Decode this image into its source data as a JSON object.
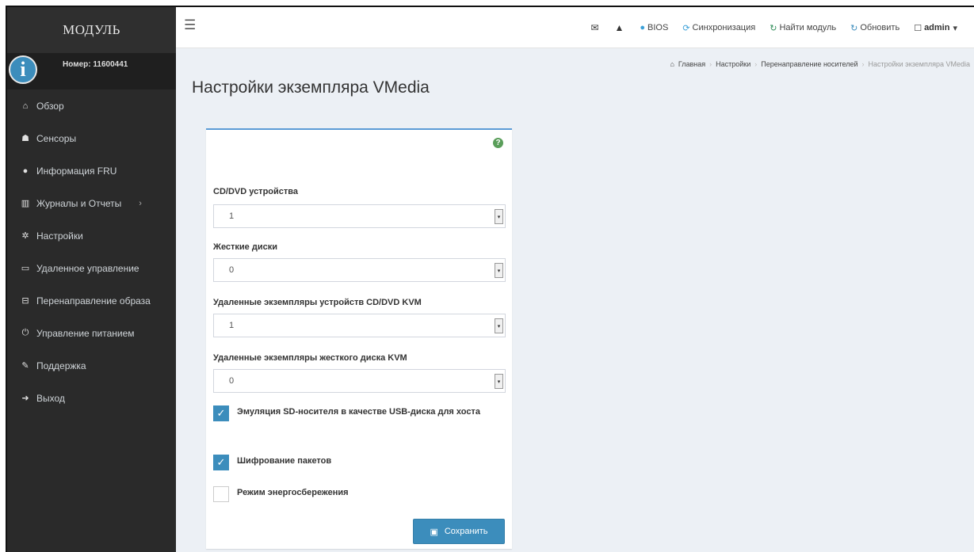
{
  "brand": "МОДУЛЬ",
  "user": {
    "number": "Номер: 11600441"
  },
  "sidebar": {
    "items": [
      {
        "label": "Обзор",
        "icon": "home-icon"
      },
      {
        "label": "Сенсоры",
        "icon": "sensors-icon"
      },
      {
        "label": "Информация FRU",
        "icon": "info-icon"
      },
      {
        "label": "Журналы и Отчеты",
        "icon": "chart-icon",
        "arrow": "›"
      },
      {
        "label": "Настройки",
        "icon": "gear-icon"
      },
      {
        "label": "Удаленное управление",
        "icon": "monitor-icon"
      },
      {
        "label": "Перенаправление образа",
        "icon": "disk-icon"
      },
      {
        "label": "Управление питанием",
        "icon": "power-icon"
      },
      {
        "label": "Поддержка",
        "icon": "wrench-icon"
      },
      {
        "label": "Выход",
        "icon": "logout-icon"
      }
    ]
  },
  "topbar": {
    "bios": "BIOS",
    "sync": "Синхронизация",
    "find_module": "Найти модуль",
    "refresh": "Обновить",
    "user": "admin"
  },
  "breadcrumb": [
    "Главная",
    "Настройки",
    "Перенаправление носителей",
    "Настройки экземпляра VMedia"
  ],
  "page_title": "Настройки экземпляра VMedia",
  "form": {
    "cd_label": "CD/DVD устройства",
    "cd_value": "1",
    "hd_label": "Жесткие диски",
    "hd_value": "0",
    "kvm_cd_label": "Удаленные экземпляры устройств CD/DVD KVM",
    "kvm_cd_value": "1",
    "kvm_hd_label": "Удаленные экземпляры жесткого диска KVM",
    "kvm_hd_value": "0",
    "sd_emulation_label": "Эмуляция SD-носителя в качестве USB-диска для хоста",
    "sd_emulation_checked": true,
    "encryption_label": "Шифрование пакетов",
    "encryption_checked": true,
    "power_saving_label": "Режим энергосбережения",
    "power_saving_checked": false,
    "save_label": "Сохранить"
  },
  "colors": {
    "accent": "#3c8dbc",
    "sidebar": "#2a2a2a",
    "content_bg": "#ecf0f5"
  }
}
